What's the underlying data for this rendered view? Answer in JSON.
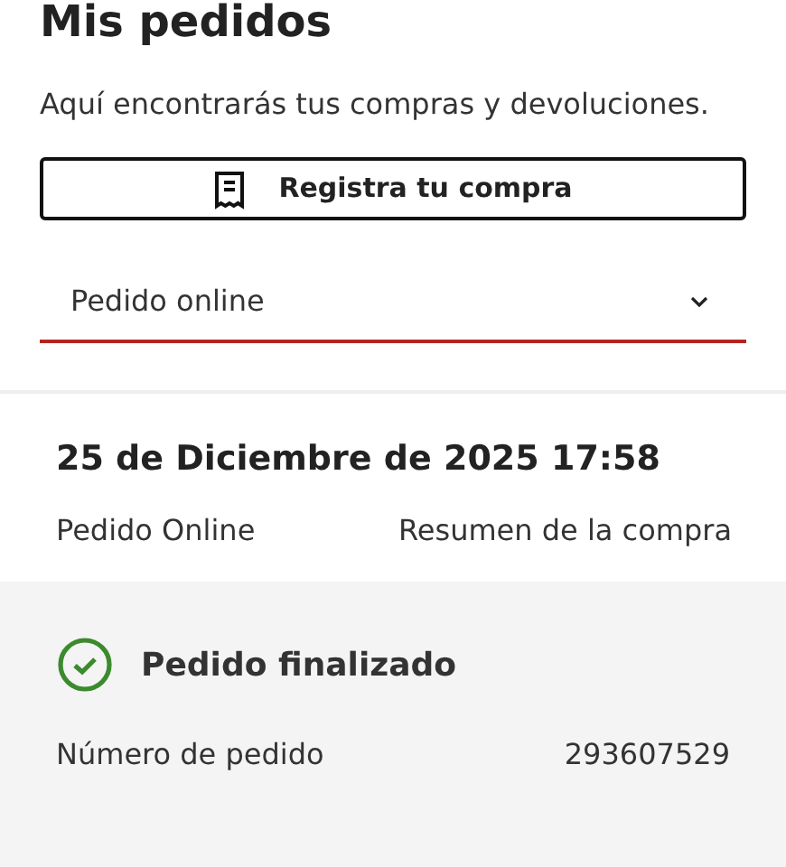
{
  "header": {
    "title": "Mis pedidos",
    "subtitle": "Aquí encontrarás tus compras y devoluciones."
  },
  "register_button": {
    "label": "Registra tu compra"
  },
  "order_type_select": {
    "value": "Pedido online"
  },
  "order": {
    "date": "25 de Diciembre de 2025 17:58",
    "channel": "Pedido Online",
    "summary_link": "Resumen de la compra",
    "status": {
      "label": "Pedido finalizado"
    },
    "fields": [
      {
        "label": "Número de pedido",
        "value": "293607529"
      }
    ]
  }
}
